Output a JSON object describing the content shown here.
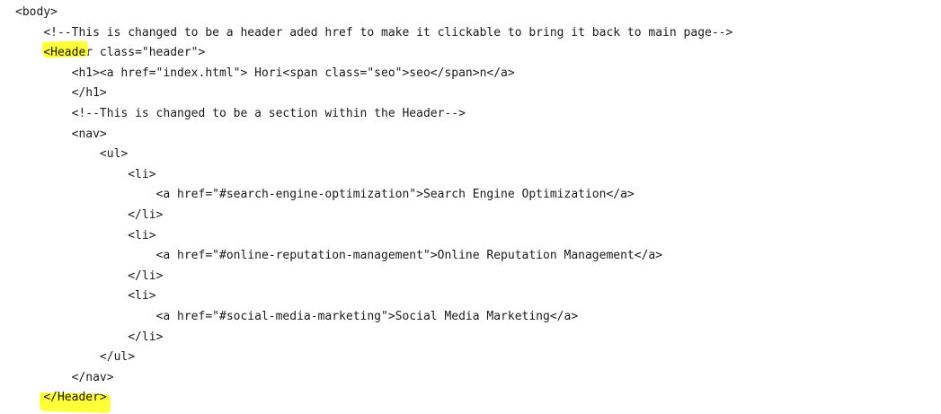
{
  "highlight_color": "#ffff3a",
  "text_color": "#1a1a1a",
  "lines": [
    {
      "indent": 0,
      "pre": "<body>",
      "hl": "",
      "post": "",
      "hl_class": ""
    },
    {
      "indent": 4,
      "pre": "<!--This is changed to be a header aded href to make it clickable to bring it back to main page-->",
      "hl": "",
      "post": "",
      "hl_class": ""
    },
    {
      "indent": 4,
      "pre": "",
      "hl": "<Heade",
      "post": "r class=\"header\">",
      "hl_class": "hl-start"
    },
    {
      "indent": 8,
      "pre": "<h1><a href=\"index.html\"> Hori<span class=\"seo\">seo</span>n</a>",
      "hl": "",
      "post": "",
      "hl_class": ""
    },
    {
      "indent": 8,
      "pre": "</h1>",
      "hl": "",
      "post": "",
      "hl_class": ""
    },
    {
      "indent": 8,
      "pre": "<!--This is changed to be a section within the Header-->",
      "hl": "",
      "post": "",
      "hl_class": ""
    },
    {
      "indent": 8,
      "pre": "<nav>",
      "hl": "",
      "post": "",
      "hl_class": ""
    },
    {
      "indent": 12,
      "pre": "<ul>",
      "hl": "",
      "post": "",
      "hl_class": ""
    },
    {
      "indent": 16,
      "pre": "<li>",
      "hl": "",
      "post": "",
      "hl_class": ""
    },
    {
      "indent": 20,
      "pre": "<a href=\"#search-engine-optimization\">Search Engine Optimization</a>",
      "hl": "",
      "post": "",
      "hl_class": ""
    },
    {
      "indent": 16,
      "pre": "</li>",
      "hl": "",
      "post": "",
      "hl_class": ""
    },
    {
      "indent": 16,
      "pre": "<li>",
      "hl": "",
      "post": "",
      "hl_class": ""
    },
    {
      "indent": 20,
      "pre": "<a href=\"#online-reputation-management\">Online Reputation Management</a>",
      "hl": "",
      "post": "",
      "hl_class": ""
    },
    {
      "indent": 16,
      "pre": "</li>",
      "hl": "",
      "post": "",
      "hl_class": ""
    },
    {
      "indent": 16,
      "pre": "<li>",
      "hl": "",
      "post": "",
      "hl_class": ""
    },
    {
      "indent": 20,
      "pre": "<a href=\"#social-media-marketing\">Social Media Marketing</a>",
      "hl": "",
      "post": "",
      "hl_class": ""
    },
    {
      "indent": 16,
      "pre": "</li>",
      "hl": "",
      "post": "",
      "hl_class": ""
    },
    {
      "indent": 12,
      "pre": "</ul>",
      "hl": "",
      "post": "",
      "hl_class": ""
    },
    {
      "indent": 8,
      "pre": "</nav>",
      "hl": "",
      "post": "",
      "hl_class": ""
    },
    {
      "indent": 4,
      "pre": "",
      "hl": "</Header>",
      "post": "",
      "hl_class": "hl-end"
    }
  ]
}
